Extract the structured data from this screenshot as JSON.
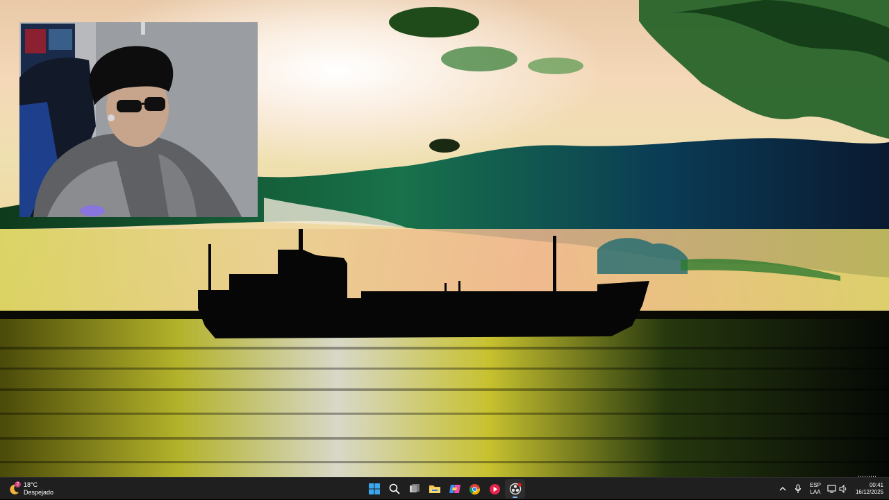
{
  "taskbar": {
    "weather": {
      "temperature": "18°C",
      "condition": "Despejado",
      "badge": "2",
      "icon": "moon-weather-icon"
    },
    "apps": [
      {
        "name": "start-button",
        "icon": "windows-icon"
      },
      {
        "name": "search-button",
        "icon": "search-icon"
      },
      {
        "name": "task-view-button",
        "icon": "task-view-icon"
      },
      {
        "name": "file-explorer-button",
        "icon": "folder-icon"
      },
      {
        "name": "copilot-button",
        "icon": "copilot-icon"
      },
      {
        "name": "chrome-button",
        "icon": "chrome-icon"
      },
      {
        "name": "media-player-button",
        "icon": "play-icon"
      },
      {
        "name": "obs-button",
        "icon": "obs-icon"
      }
    ],
    "tray": {
      "language_top": "ESP",
      "language_bottom": "LAA",
      "time": "00:41",
      "date": "16/12/2025"
    }
  },
  "colors": {
    "taskbar_bg": "#1f1f1f",
    "windows_blue": "#3aa7f0",
    "folder_yellow": "#f5c344",
    "media_red": "#e5244d",
    "sky_cream": "#f3dfb6",
    "cloud_green": "#1f6b2b",
    "water_yellow": "#c6c63a"
  }
}
